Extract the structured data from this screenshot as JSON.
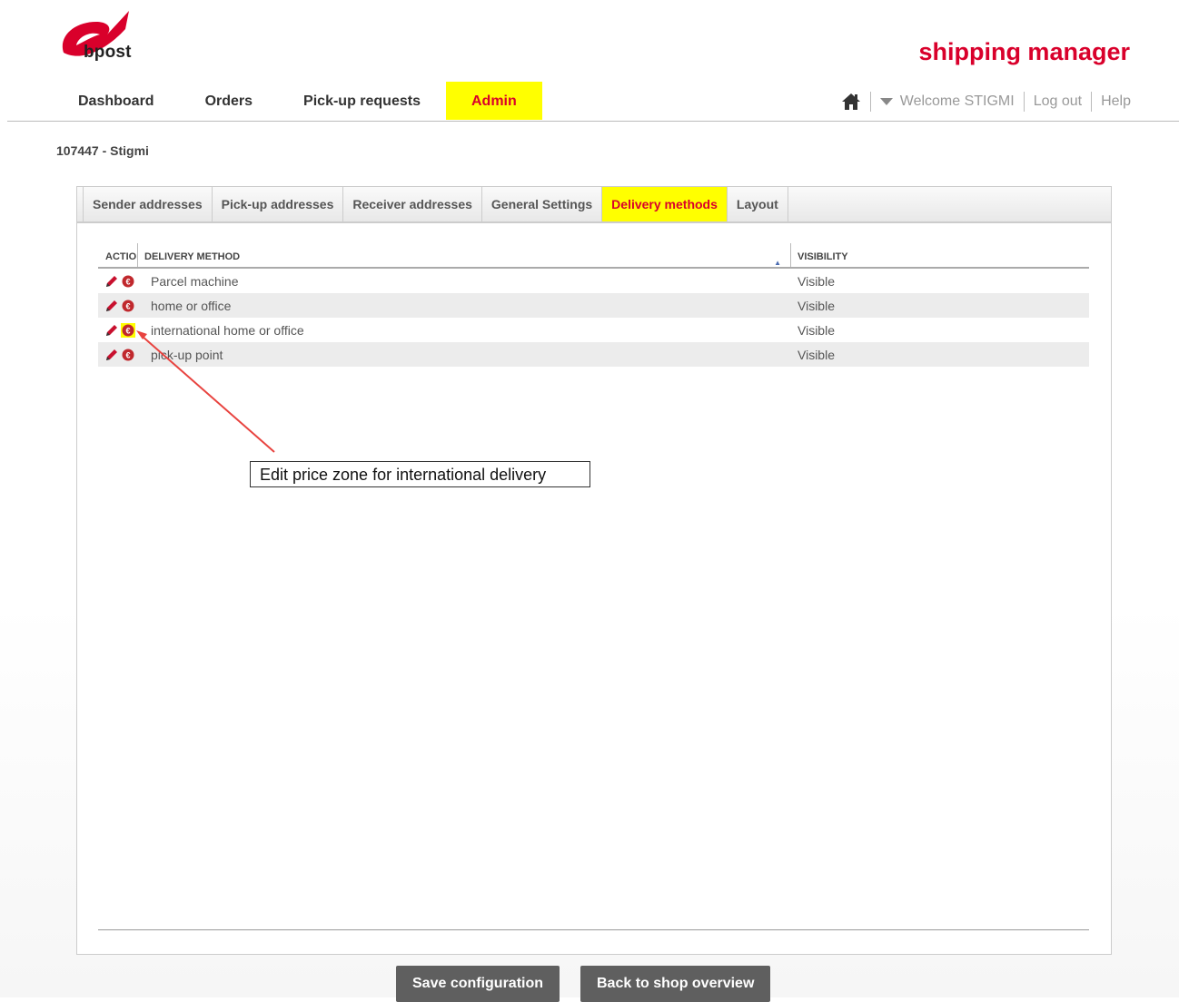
{
  "brand": {
    "logo_text": "bpost",
    "app_title": "shipping manager",
    "accent": "#d9002b",
    "highlight": "#ffff00"
  },
  "nav": {
    "items": [
      {
        "label": "Dashboard",
        "active": false
      },
      {
        "label": "Orders",
        "active": false
      },
      {
        "label": "Pick-up requests",
        "active": false
      },
      {
        "label": "Admin",
        "active": true
      }
    ]
  },
  "topbar": {
    "home_icon": "home-icon",
    "welcome": "Welcome STIGMI",
    "logout": "Log out",
    "help": "Help"
  },
  "shop": {
    "id_label": "107447 - Stigmi"
  },
  "tabs": [
    {
      "label": "Sender addresses",
      "active": false
    },
    {
      "label": "Pick-up addresses",
      "active": false
    },
    {
      "label": "Receiver addresses",
      "active": false
    },
    {
      "label": "General Settings",
      "active": false
    },
    {
      "label": "Delivery methods",
      "active": true
    },
    {
      "label": "Layout",
      "active": false
    }
  ],
  "grid": {
    "columns": [
      "ACTIONS",
      "DELIVERY METHOD",
      "VISIBILITY"
    ],
    "rows": [
      {
        "method": "Parcel machine",
        "visibility": "Visible"
      },
      {
        "method": "home or office",
        "visibility": "Visible"
      },
      {
        "method": "international home or office",
        "visibility": "Visible"
      },
      {
        "method": "pick-up point",
        "visibility": "Visible"
      }
    ]
  },
  "annotation": {
    "text": "Edit price zone for international delivery"
  },
  "buttons": {
    "save": "Save configuration",
    "back": "Back to shop overview"
  }
}
